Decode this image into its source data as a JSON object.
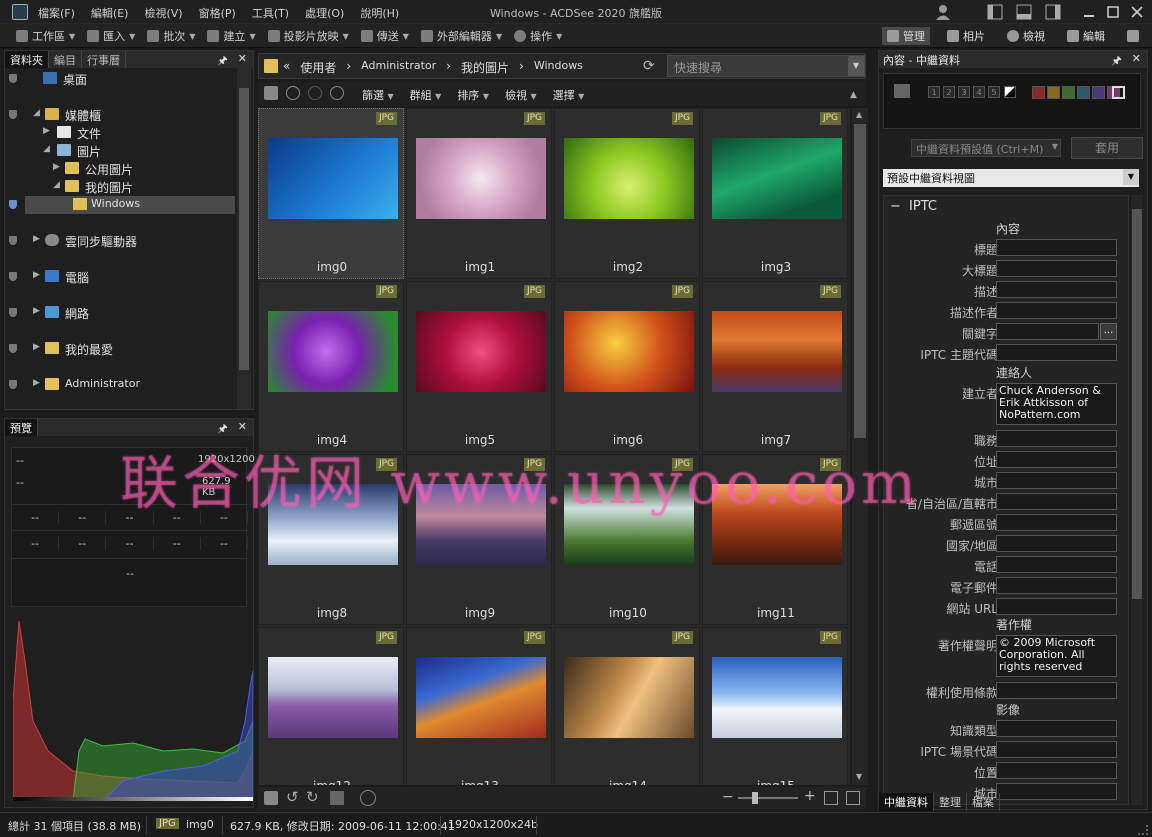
{
  "window": {
    "title": "Windows - ACDSee 2020 旗艦版",
    "menu": [
      "檔案(F)",
      "編輯(E)",
      "檢視(V)",
      "窗格(P)",
      "工具(T)",
      "處理(O)",
      "說明(H)"
    ]
  },
  "toolbar": {
    "tools": [
      "工作區",
      "匯入",
      "批次",
      "建立",
      "投影片放映",
      "傳送",
      "外部編輯器",
      "操作"
    ],
    "modes": [
      "管理",
      "相片",
      "檢視",
      "編輯"
    ],
    "active_mode": "管理"
  },
  "left_panel": {
    "tabs": [
      "資料夾",
      "編目",
      "行事曆"
    ],
    "active_tab": "資料夾",
    "tree": [
      {
        "label": "桌面",
        "level": 0
      },
      {
        "label": "媒體櫃",
        "level": 0
      },
      {
        "label": "文件",
        "level": 1
      },
      {
        "label": "圖片",
        "level": 1
      },
      {
        "label": "公用圖片",
        "level": 2
      },
      {
        "label": "我的圖片",
        "level": 2
      },
      {
        "label": "Windows",
        "level": 3
      },
      {
        "label": "雲同步驅動器",
        "level": 0
      },
      {
        "label": "電腦",
        "level": 0
      },
      {
        "label": "網路",
        "level": 0
      },
      {
        "label": "我的最愛",
        "level": 0
      },
      {
        "label": "Administrator",
        "level": 0
      }
    ]
  },
  "preview_panel": {
    "title": "預覽",
    "dash": "--",
    "resolution": "1920x1200",
    "size": "627.9 KB"
  },
  "breadcrumb": {
    "items": [
      "«",
      "使用者",
      "Administrator",
      "我的圖片",
      "Windows"
    ],
    "search_placeholder": "快速搜尋"
  },
  "view_toolbar": {
    "items": [
      "篩選",
      "群組",
      "排序",
      "檢視",
      "選擇"
    ]
  },
  "thumbnails": [
    {
      "name": "img0",
      "format": "JPG"
    },
    {
      "name": "img1",
      "format": "JPG"
    },
    {
      "name": "img2",
      "format": "JPG"
    },
    {
      "name": "img3",
      "format": "JPG"
    },
    {
      "name": "img4",
      "format": "JPG"
    },
    {
      "name": "img5",
      "format": "JPG"
    },
    {
      "name": "img6",
      "format": "JPG"
    },
    {
      "name": "img7",
      "format": "JPG"
    },
    {
      "name": "img8",
      "format": "JPG"
    },
    {
      "name": "img9",
      "format": "JPG"
    },
    {
      "name": "img10",
      "format": "JPG"
    },
    {
      "name": "img11",
      "format": "JPG"
    },
    {
      "name": "img12",
      "format": "JPG"
    },
    {
      "name": "img13",
      "format": "JPG"
    },
    {
      "name": "img14",
      "format": "JPG"
    },
    {
      "name": "img15",
      "format": "JPG"
    }
  ],
  "right_panel": {
    "title": "內容 - 中繼資料",
    "rating_numbers": [
      "1",
      "2",
      "3",
      "4",
      "5"
    ],
    "color_labels": [
      "#8b2a2a",
      "#8a6a20",
      "#3d6e2e",
      "#2e5a6e",
      "#4a3a7a",
      "#7a3a6a"
    ],
    "preset_placeholder": "中繼資料預設值 (Ctrl+M)",
    "apply_label": "套用",
    "view_select": "預設中繼資料視圖",
    "section": "IPTC",
    "groups": {
      "content": "內容",
      "contact": "連絡人",
      "copyright": "著作權",
      "image": "影像"
    },
    "fields": [
      {
        "label": "標題",
        "value": ""
      },
      {
        "label": "大標題",
        "value": ""
      },
      {
        "label": "描述",
        "value": ""
      },
      {
        "label": "描述作者",
        "value": ""
      },
      {
        "label": "關鍵字",
        "value": ""
      },
      {
        "label": "IPTC 主題代碼",
        "value": ""
      },
      {
        "label": "建立者",
        "value": "Chuck Anderson & Erik Attkisson of NoPattern.com"
      },
      {
        "label": "職務",
        "value": ""
      },
      {
        "label": "位址",
        "value": ""
      },
      {
        "label": "城市",
        "value": ""
      },
      {
        "label": "省/自治區/直轄市",
        "value": ""
      },
      {
        "label": "郵遞區號",
        "value": ""
      },
      {
        "label": "國家/地區",
        "value": ""
      },
      {
        "label": "電話",
        "value": ""
      },
      {
        "label": "電子郵件",
        "value": ""
      },
      {
        "label": "網站 URL",
        "value": ""
      },
      {
        "label": "著作權聲明",
        "value": "© 2009 Microsoft Corporation.  All rights reserved"
      },
      {
        "label": "權利使用條款",
        "value": ""
      },
      {
        "label": "知識類型",
        "value": ""
      },
      {
        "label": "IPTC 場景代碼",
        "value": ""
      },
      {
        "label": "位置",
        "value": ""
      },
      {
        "label": "城市",
        "value": ""
      }
    ],
    "bottom_tabs": [
      "中繼資料",
      "整理",
      "檔案"
    ],
    "active_bottom_tab": "中繼資料"
  },
  "status": {
    "total": "總計 31 個項目 (38.8 MB)",
    "format": "JPG",
    "file": "img0",
    "info": "627.9 KB, 修改日期: 2009-06-11 12:00:41",
    "dims": "1920x1200x24b"
  },
  "watermark": "联合优网 www.unyoo.com"
}
